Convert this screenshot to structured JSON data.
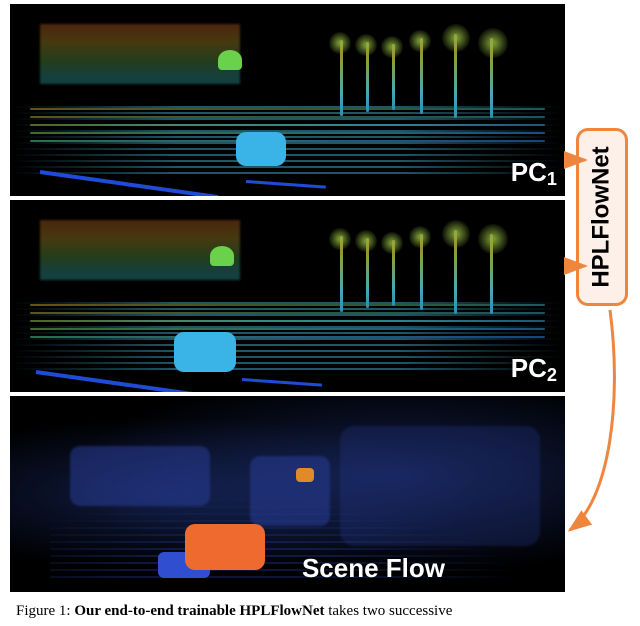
{
  "figure": {
    "panels": {
      "pc1": {
        "label_base": "PC",
        "label_sub": "1"
      },
      "pc2": {
        "label_base": "PC",
        "label_sub": "2"
      },
      "sceneflow": {
        "label": "Scene Flow"
      }
    },
    "module": {
      "name": "HPLFlowNet"
    },
    "arrows": {
      "color": "#ee863e"
    }
  },
  "caption": {
    "prefix": "Figure 1: ",
    "bold": "Our end-to-end trainable HPLFlowNet",
    "tail": " takes two successive"
  }
}
